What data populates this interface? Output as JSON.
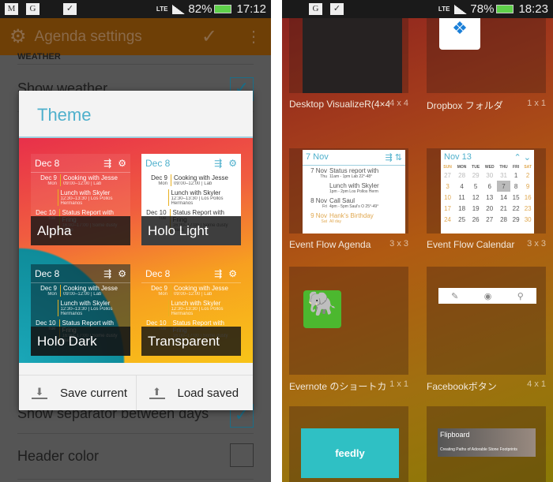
{
  "left": {
    "status": {
      "lte": "LTE",
      "battery": "82%",
      "time": "17:12",
      "icons": [
        "gmail-icon",
        "google-icon",
        "shopping-bag-icon"
      ]
    },
    "action_bar": {
      "title": "Agenda settings"
    },
    "settings": {
      "section": "WEATHER",
      "show_weather": "Show weather",
      "show_separator": "Show separator between days",
      "header_color": "Header color",
      "show_weather_checked": true,
      "show_separator_checked": true
    },
    "dialog": {
      "title": "Theme",
      "preview": {
        "header_date": "Dec 8",
        "events": [
          {
            "date": "Dec 9",
            "day": "Mon",
            "title": "Cooking with Jesse",
            "sub": "09:00–12:00 | Lab"
          },
          {
            "date": "",
            "day": "",
            "title": "Lunch with Skyler",
            "sub": "12:30–13:30 | Los Pollos Hermanos"
          },
          {
            "date": "Dec 10",
            "day": "Tue",
            "title": "Status Report with Fring",
            "sub": "16:00–17:00 | Some dusty place"
          }
        ]
      },
      "themes": [
        {
          "label": "Alpha"
        },
        {
          "label": "Holo Light"
        },
        {
          "label": "Holo Dark"
        },
        {
          "label": "Transparent"
        }
      ],
      "save_label": "Save current",
      "load_label": "Load saved"
    }
  },
  "right": {
    "status": {
      "lte": "LTE",
      "battery": "78%",
      "time": "18:23"
    },
    "widgets": [
      {
        "name": "Desktop VisualizeR(4×4)",
        "size": "4 x 4"
      },
      {
        "name": "Dropbox フォルダ",
        "size": "1 x 1"
      },
      {
        "name": "Event Flow Agenda",
        "size": "3 x 3"
      },
      {
        "name": "Event Flow Calendar",
        "size": "3 x 3"
      },
      {
        "name": "Evernote のショートカ",
        "size": "1 x 1"
      },
      {
        "name": "Facebookボタン",
        "size": "4 x 1"
      }
    ],
    "agenda": {
      "header": "7 Nov",
      "rows": [
        {
          "date": "7 Nov",
          "day": "Thu",
          "title": "Status report with",
          "sub": "11am - 1pm  Lab  22°-48°"
        },
        {
          "date": "",
          "day": "",
          "title": "Lunch with Skyler",
          "sub": "1pm - 2pm  Los Pollos Herm"
        },
        {
          "date": "8 Nov",
          "day": "Fri",
          "title": "Call Saul",
          "sub": "4pm - 5pm  Saul's O  25°-49°"
        },
        {
          "date": "9 Nov",
          "day": "Sat",
          "title": "Hank's Birthday",
          "sub": "All day"
        }
      ]
    },
    "calendar": {
      "header": "Nov 13",
      "weekdays": [
        "SUN",
        "MON",
        "TUE",
        "WED",
        "THU",
        "FRI",
        "SAT"
      ],
      "weeks": [
        [
          "27",
          "28",
          "29",
          "30",
          "31",
          "1",
          "2"
        ],
        [
          "3",
          "4",
          "5",
          "6",
          "7",
          "8",
          "9"
        ],
        [
          "10",
          "11",
          "12",
          "13",
          "14",
          "15",
          "16"
        ],
        [
          "17",
          "18",
          "19",
          "20",
          "21",
          "22",
          "23"
        ],
        [
          "24",
          "25",
          "26",
          "27",
          "28",
          "29",
          "30"
        ]
      ],
      "selected": "7"
    },
    "feedly": "feedly",
    "flipboard": {
      "brand": "Flipboard",
      "caption": "Creating Paths of Adorable Stone Footprints"
    }
  },
  "colors": {
    "accent": "#4fb0cc",
    "action_bar": "#6e3f06"
  }
}
